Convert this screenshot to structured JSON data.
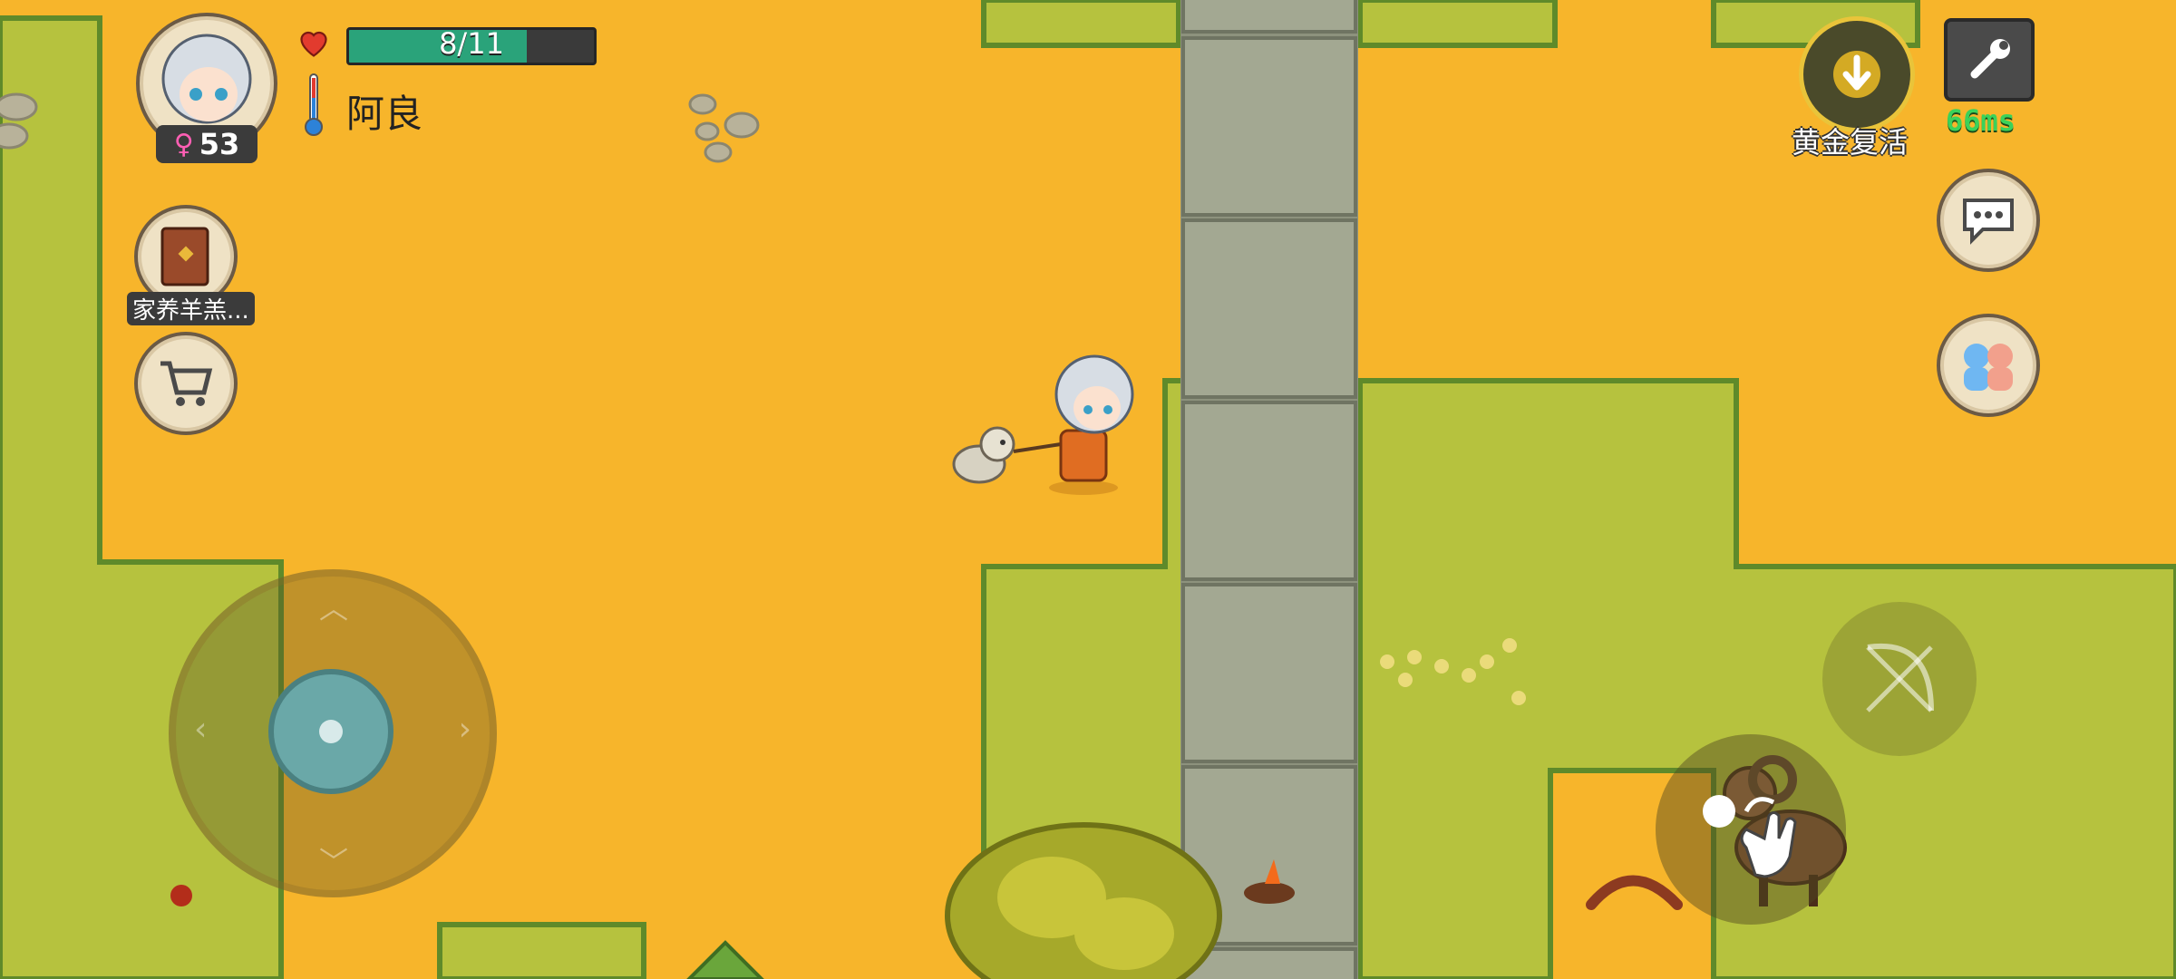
{
  "player": {
    "health_text": "8/11",
    "health_fraction": 0.727,
    "name": "阿良",
    "age_badge": "53",
    "gender_symbol": "♀"
  },
  "quick_items": [
    {
      "label": "家养羊羔...",
      "icon": "book-icon"
    },
    {
      "label": "",
      "icon": "shopping-cart-icon"
    }
  ],
  "top_right": {
    "revive_label": "黄金复活",
    "ping_text": "66ms"
  },
  "colors": {
    "grass": "#b5c13d",
    "ground": "#f7b52b",
    "stone_path": "#9a9f8a",
    "health_bar": "#2aa37a",
    "ping": "#3ad25a"
  }
}
